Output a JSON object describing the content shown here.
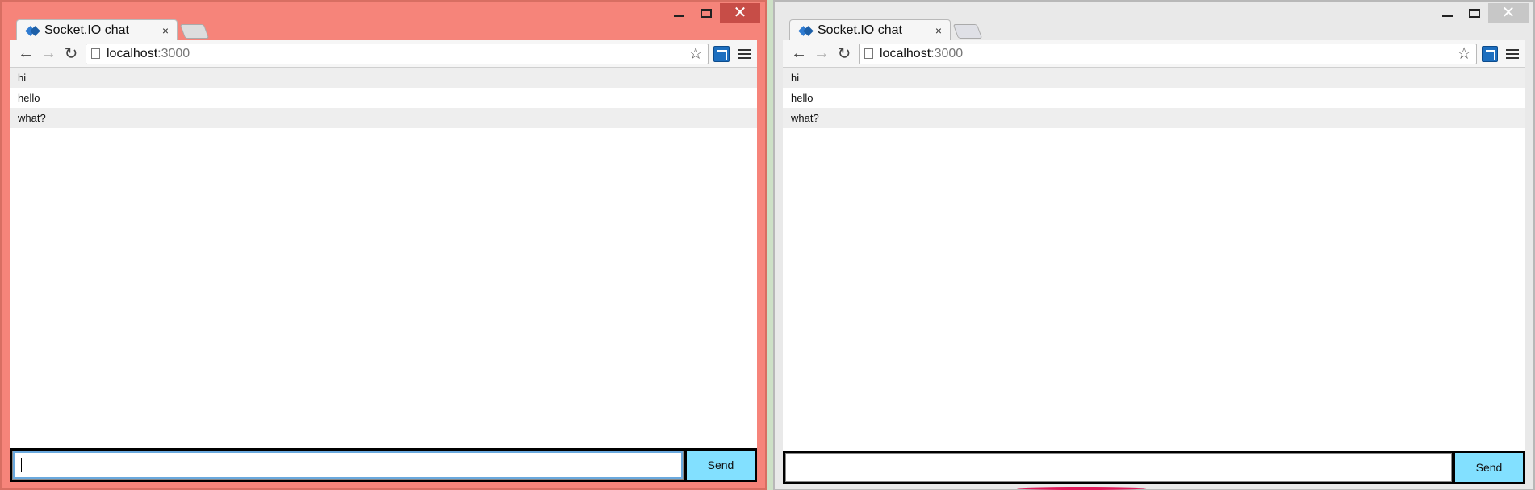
{
  "colors": {
    "active_frame": "#f6847a",
    "inactive_frame": "#e9e9e9",
    "message_alt_bg": "#eeeeee",
    "send_button_bg": "#82e0ff",
    "form_bg": "#000000"
  },
  "window1": {
    "tab": {
      "title": "Socket.IO chat",
      "close": "×"
    },
    "controls": {
      "close": "✕"
    },
    "address": {
      "host": "localhost",
      "port": ":3000"
    },
    "messages": [
      "hi",
      "hello",
      "what?"
    ],
    "form": {
      "input_value": "",
      "send_label": "Send"
    }
  },
  "window2": {
    "tab": {
      "title": "Socket.IO chat",
      "close": "×"
    },
    "controls": {
      "close": "✕"
    },
    "address": {
      "host": "localhost",
      "port": ":3000"
    },
    "messages": [
      "hi",
      "hello",
      "what?"
    ],
    "form": {
      "input_value": "",
      "send_label": "Send"
    }
  },
  "icons": {
    "back": "back-arrow-icon",
    "forward": "forward-arrow-icon",
    "reload": "reload-icon",
    "star": "star-icon",
    "extension": "extension-icon",
    "menu": "hamburger-menu-icon"
  }
}
